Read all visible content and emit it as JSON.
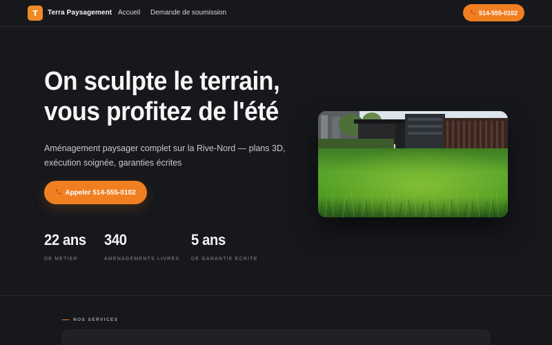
{
  "nav": {
    "logo_letter": "T",
    "brand": "Terra Paysagement",
    "links": [
      "Accueil",
      "Demande de soumission"
    ],
    "phone_cta": "514-555-0102"
  },
  "hero": {
    "title_line1": "On sculpte le terrain,",
    "title_line2": "vous profitez de l'été",
    "subtitle_line1": "Aménagement paysager complet sur la Rive-Nord — plans 3D,",
    "subtitle_line2": "exécution soignée, garanties écrites",
    "cta": "Appeler 514-555-0102",
    "image_icon": "lawn-photo"
  },
  "stats": [
    {
      "value": "22 ans",
      "label": "DE MÉTIER"
    },
    {
      "value": "340",
      "label": "AMÉNAGEMENTS LIVRÉS"
    },
    {
      "value": "5 ans",
      "label": "DE GARANTIE ÉCRITE"
    }
  ],
  "services": {
    "eyebrow": "NOS SERVICES"
  },
  "icons": {
    "phone": "phone-icon"
  },
  "colors": {
    "accent": "#f07f22",
    "background": "#17181c"
  }
}
